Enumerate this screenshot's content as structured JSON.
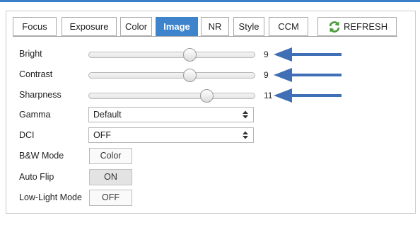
{
  "tabs": [
    {
      "label": "Focus",
      "active": false
    },
    {
      "label": "Exposure",
      "active": false
    },
    {
      "label": "Color",
      "active": false
    },
    {
      "label": "Image",
      "active": true
    },
    {
      "label": "NR",
      "active": false
    },
    {
      "label": "Style",
      "active": false
    },
    {
      "label": "CCM",
      "active": false
    }
  ],
  "refresh": {
    "label": "REFRESH",
    "icon": "refresh-icon",
    "icon_color": "#4a9a3a"
  },
  "sliders": [
    {
      "label": "Bright",
      "value": "9",
      "level": 0.61
    },
    {
      "label": "Contrast",
      "value": "9",
      "level": 0.61
    },
    {
      "label": "Sharpness",
      "value": "11",
      "level": 0.71
    }
  ],
  "selects": [
    {
      "label": "Gamma",
      "value": "Default"
    },
    {
      "label": "DCI",
      "value": "OFF"
    }
  ],
  "buttons": [
    {
      "label": "B&W Mode",
      "value": "Color"
    },
    {
      "label": "Auto Flip",
      "value": "ON"
    },
    {
      "label": "Low-Light Mode",
      "value": "OFF"
    }
  ],
  "colors": {
    "accent": "#3d84cc",
    "annotation_arrow": "#3f6fb5"
  }
}
